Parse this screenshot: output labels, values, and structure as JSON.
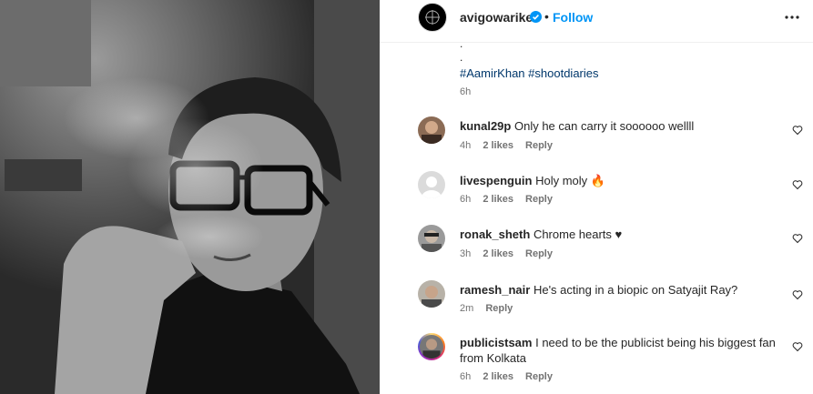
{
  "post": {
    "username": "avigowariker",
    "follow_label": "Follow",
    "separator": "•",
    "more_icon": "more-horizontal-icon",
    "caption_dots": [
      ".",
      "."
    ],
    "hashtags": [
      "#AamirKhan",
      "#shootdiaries"
    ],
    "caption_time": "6h"
  },
  "comments": [
    {
      "user": "kunal29p",
      "text": "Only he can carry it soooooo wellll",
      "time": "4h",
      "likes": "2 likes",
      "reply": "Reply"
    },
    {
      "user": "livespenguin",
      "text": "Holy moly 🔥",
      "time": "6h",
      "likes": "2 likes",
      "reply": "Reply"
    },
    {
      "user": "ronak_sheth",
      "text": "Chrome hearts ♥",
      "time": "3h",
      "likes": "2 likes",
      "reply": "Reply"
    },
    {
      "user": "ramesh_nair",
      "text": "He's acting in a biopic on Satyajit Ray?",
      "time": "2m",
      "likes": "",
      "reply": "Reply"
    },
    {
      "user": "publicistsam",
      "text": "I need to be the publicist being his biggest fan from Kolkata",
      "time": "6h",
      "likes": "2 likes",
      "reply": "Reply"
    }
  ],
  "colors": {
    "link": "#0095f6",
    "hashtag": "#00376b",
    "muted": "#737373"
  }
}
